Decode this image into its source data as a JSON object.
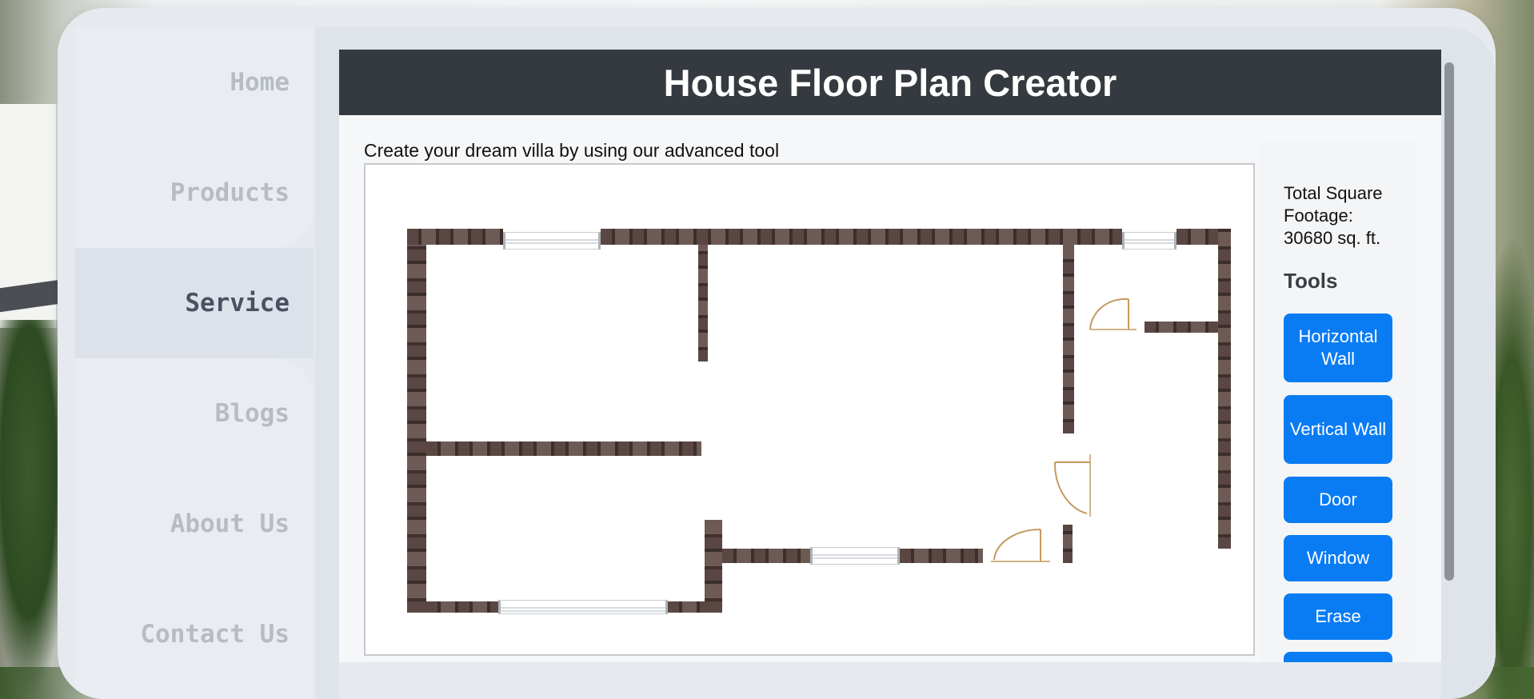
{
  "nav": {
    "items": [
      {
        "label": "Home"
      },
      {
        "label": "Products"
      },
      {
        "label": "Service"
      },
      {
        "label": "Blogs"
      },
      {
        "label": "About Us"
      },
      {
        "label": "Contact Us"
      }
    ],
    "active": "Service"
  },
  "header": {
    "title": "House Floor Plan Creator"
  },
  "main": {
    "subtitle": "Create your dream villa by using our advanced tool"
  },
  "sidebar": {
    "square_footage_label": "Total Square Footage:",
    "square_footage_value": "30680 sq. ft.",
    "tools_title": "Tools",
    "tools": [
      "Horizontal Wall",
      "Vertical Wall",
      "Door",
      "Window",
      "Erase",
      ""
    ]
  },
  "colors": {
    "header_bg": "#343a40",
    "button": "#0a7cf3",
    "active_nav_text": "#4a5160"
  }
}
